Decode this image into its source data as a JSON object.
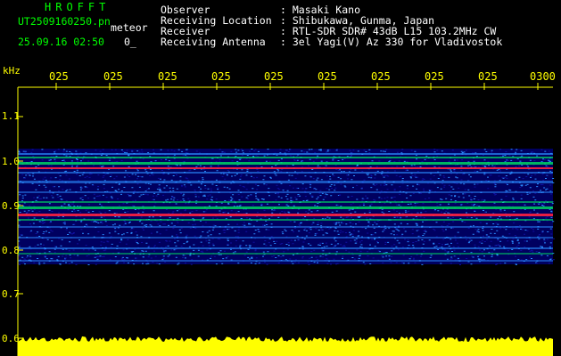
{
  "header": {
    "app_title": "HROFFT",
    "file_name": "UT2509160250.pn",
    "mode_label": "meteor",
    "timestamp": "25.09.16 02:50",
    "count": "0_",
    "info": [
      {
        "label": "Observer",
        "value": ": Masaki Kano"
      },
      {
        "label": "Receiving Location",
        "value": ": Shibukawa, Gunma, Japan"
      },
      {
        "label": "Receiver",
        "value": ": RTL-SDR SDR# 43dB L15 103.2MHz CW"
      },
      {
        "label": "Receiving Antenna",
        "value": ": 3el Yagi(V) Az 330 for Vladivostok"
      }
    ]
  },
  "plot": {
    "unit_label": "kHz",
    "x_ticks": [
      "025",
      "025",
      "025",
      "025",
      "025",
      "025",
      "025",
      "025",
      "025",
      "0300"
    ],
    "y_ticks": [
      "1.1",
      "1.0",
      "0.9",
      "0.8",
      "0.7",
      "0.6"
    ],
    "colors": {
      "axis": "#ffff00",
      "grid": "#6060ff",
      "noise_low": "#1010a0",
      "noise_mid": "#2a8cff",
      "signal_mid": "#00e060",
      "signal_high": "#ff2040",
      "strength_bar": "#ffff00"
    }
  }
}
